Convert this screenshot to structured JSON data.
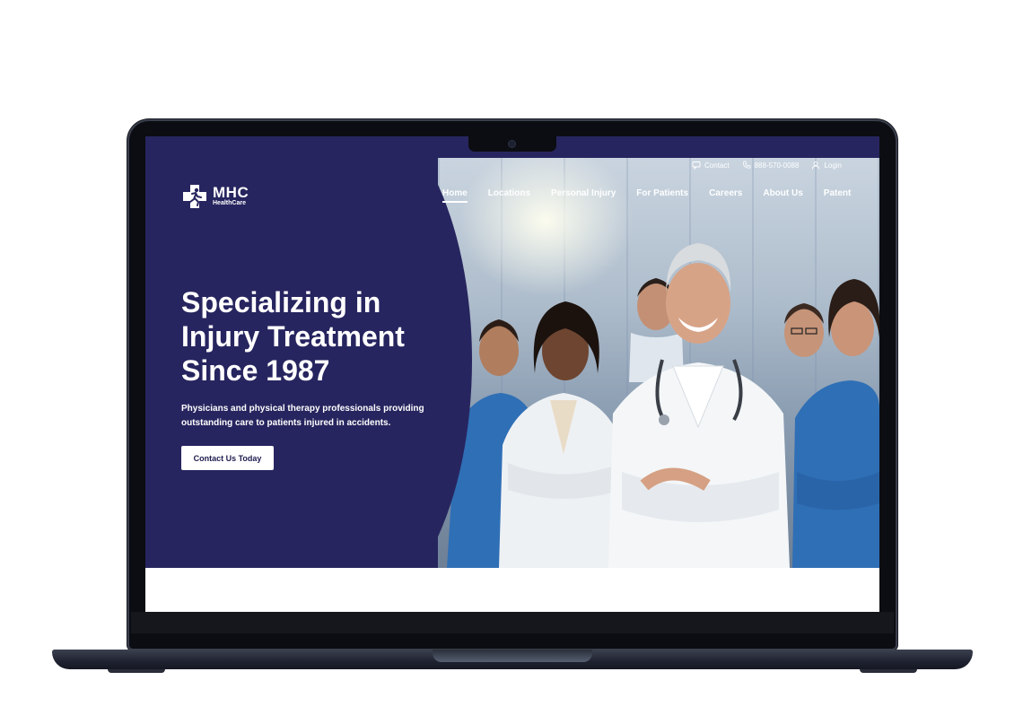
{
  "site": {
    "logo": {
      "name": "MHC",
      "sub": "HealthCare"
    },
    "utility_bar": {
      "contact_label": "Contact",
      "phone": "888-570-0088",
      "login_label": "Login"
    },
    "nav": [
      {
        "label": "Home",
        "active": true
      },
      {
        "label": "Locations"
      },
      {
        "label": "Personal Injury"
      },
      {
        "label": "For Patients"
      },
      {
        "label": "Careers"
      },
      {
        "label": "About Us"
      },
      {
        "label": "Patent"
      }
    ],
    "hero": {
      "heading_lines": [
        "Specializing in",
        "Injury Treatment",
        "Since 1987"
      ],
      "subtext_lines": [
        "Physicians and physical therapy professionals providing",
        "outstanding care to patients injured in accidents."
      ],
      "cta_label": "Contact Us Today"
    },
    "colors": {
      "brand_navy": "#27255f",
      "scrub_blue": "#2f6fb6",
      "white": "#ffffff"
    }
  }
}
